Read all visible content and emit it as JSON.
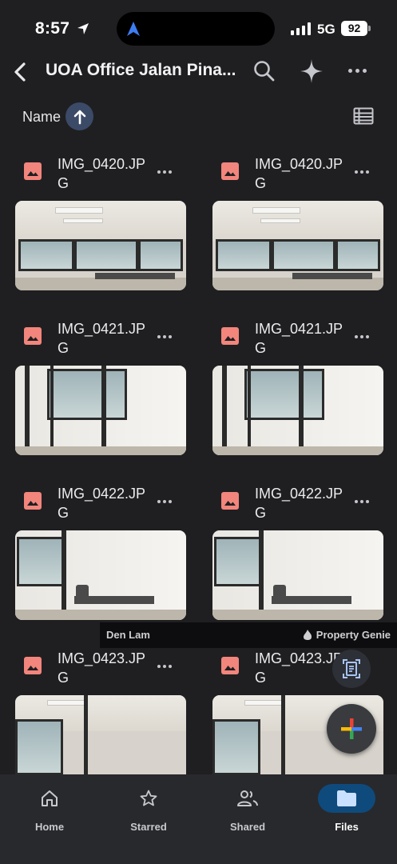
{
  "status_bar": {
    "time": "8:57",
    "network": "5G",
    "battery": "92"
  },
  "header": {
    "title": "UOA Office Jalan Pina..."
  },
  "sort": {
    "label": "Name"
  },
  "files": [
    {
      "name": "IMG_0420.JPG"
    },
    {
      "name": "IMG_0420.JPG"
    },
    {
      "name": "IMG_0421.JPG"
    },
    {
      "name": "IMG_0421.JPG"
    },
    {
      "name": "IMG_0422.JPG"
    },
    {
      "name": "IMG_0422.JPG"
    },
    {
      "name": "IMG_0423.JPG"
    },
    {
      "name": "IMG_0423.JPG"
    }
  ],
  "watermark": {
    "left": "Den Lam",
    "right": "Property Genie"
  },
  "nav": [
    {
      "label": "Home",
      "icon": "home-icon"
    },
    {
      "label": "Starred",
      "icon": "star-icon"
    },
    {
      "label": "Shared",
      "icon": "people-icon"
    },
    {
      "label": "Files",
      "icon": "folder-icon",
      "active": true
    }
  ],
  "colors": {
    "background": "#1f1f21",
    "accent": "#0f4a7d",
    "file_icon": "#f2857c",
    "sort_button": "#3b4a67"
  }
}
